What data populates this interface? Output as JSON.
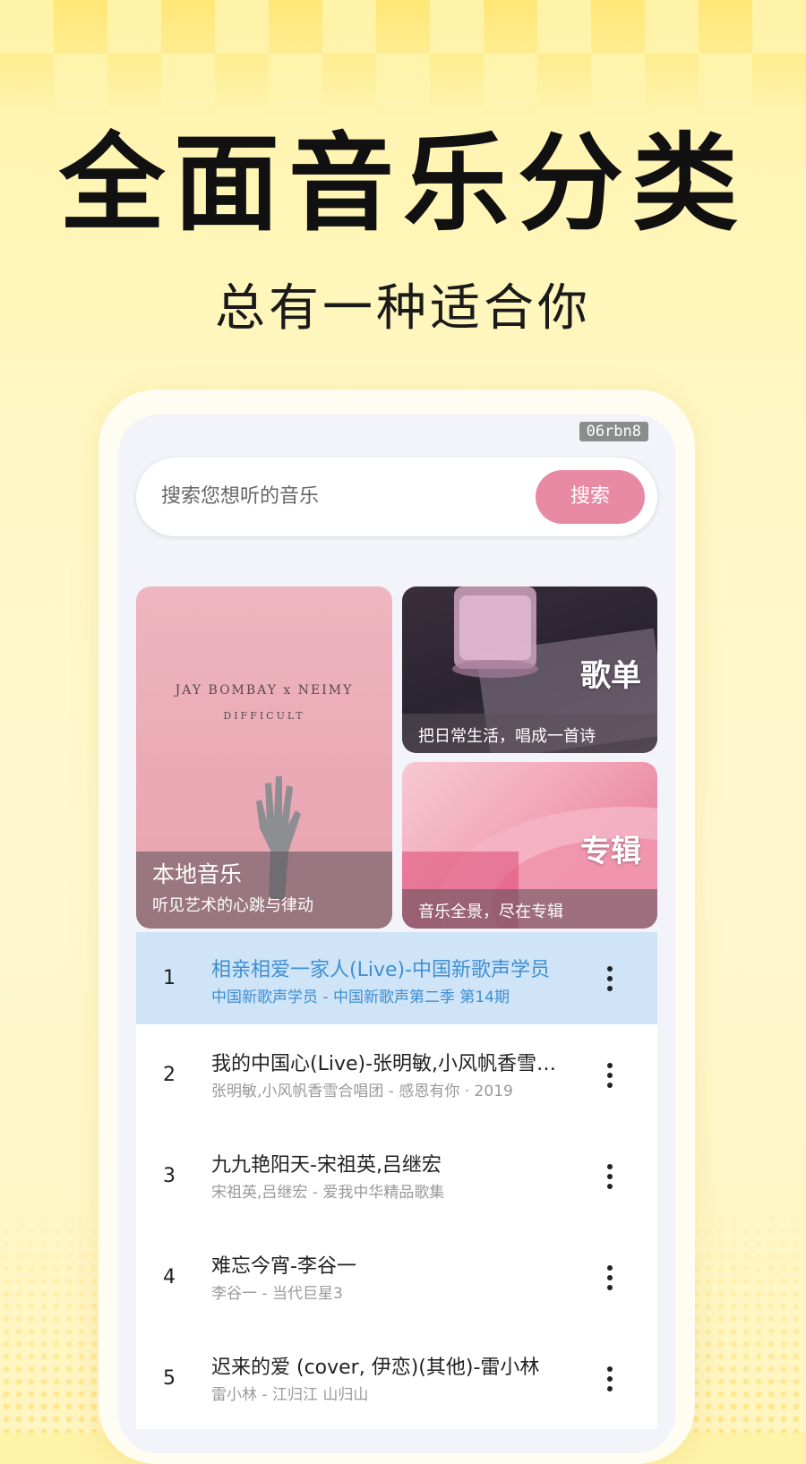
{
  "promo": {
    "headline": "全面音乐分类",
    "subline": "总有一种适合你"
  },
  "overlay_tag": "06rbn8",
  "search": {
    "placeholder": "搜索您想听的音乐",
    "button_label": "搜索"
  },
  "categories": {
    "local": {
      "cover_artist": "JAY BOMBAY x NEIMY",
      "cover_title": "DIFFICULT",
      "title": "本地音乐",
      "desc": "听见艺术的心跳与律动"
    },
    "playlist": {
      "title": "歌单",
      "desc": "把日常生活，唱成一首诗"
    },
    "album": {
      "title": "专辑",
      "desc": "音乐全景，尽在专辑"
    }
  },
  "songs": [
    {
      "rank": "1",
      "title": "相亲相爱一家人(Live)-中国新歌声学员",
      "subtitle": "中国新歌声学员 - 中国新歌声第二季 第14期",
      "active": true
    },
    {
      "rank": "2",
      "title": "我的中国心(Live)-张明敏,小风帆香雪合唱团",
      "subtitle": "张明敏,小风帆香雪合唱团 - 感恩有你 · 2019",
      "active": false
    },
    {
      "rank": "3",
      "title": "九九艳阳天-宋祖英,吕继宏",
      "subtitle": "宋祖英,吕继宏 - 爱我中华精品歌集",
      "active": false
    },
    {
      "rank": "4",
      "title": "难忘今宵-李谷一",
      "subtitle": "李谷一 - 当代巨星3",
      "active": false
    },
    {
      "rank": "5",
      "title": "迟来的爱 (cover, 伊恋)(其他)-雷小林",
      "subtitle": "雷小林 - 江归江   山归山",
      "active": false
    }
  ],
  "colors": {
    "search_button": "#e98aa4",
    "active_row_bg": "#cfe4f7",
    "active_row_text": "#3f8fd2"
  }
}
